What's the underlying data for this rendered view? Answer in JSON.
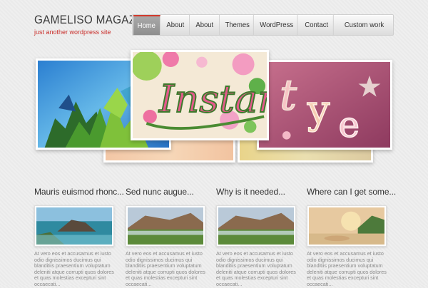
{
  "site": {
    "title": "GAMELISO MAGAZINE",
    "tagline": "just another wordpress site"
  },
  "nav": {
    "items": [
      "Home",
      "About",
      "About",
      "Themes",
      "WordPress",
      "Contact",
      "Custom work"
    ],
    "active_index": 0
  },
  "slider": {
    "slides": [
      {
        "name": "crystals"
      },
      {
        "name": "instant"
      },
      {
        "name": "type"
      }
    ]
  },
  "posts": [
    {
      "title": "Mauris euismod rhonc...",
      "excerpt": "At vero eos et accusamus et iusto odio dignissimos ducimus qui blanditiis praesentium voluptatum deleniti atque corrupti quos dolores et quas molestias excepturi sint occaecati..."
    },
    {
      "title": "Sed nunc augue...",
      "excerpt": "At vero eos et accusamus et iusto odio dignissimos ducimus qui blanditiis praesentium voluptatum deleniti atque corrupti quos dolores et quas molestias excepturi sint occaecati..."
    },
    {
      "title": "Why is it needed...",
      "excerpt": "At vero eos et accusamus et iusto odio dignissimos ducimus qui blanditiis praesentium voluptatum deleniti atque corrupti quos dolores et quas molestias excepturi sint occaecati..."
    },
    {
      "title": "Where can I get some...",
      "excerpt": "At vero eos et accusamus et iusto odio dignissimos ducimus qui blanditiis praesentium voluptatum deleniti atque corrupti quos dolores et quas molestias excepturi sint occaecati..."
    }
  ],
  "colors": {
    "accent": "#d23a2c",
    "title": "#3b3b3b",
    "excerpt": "#8a8a8a"
  }
}
